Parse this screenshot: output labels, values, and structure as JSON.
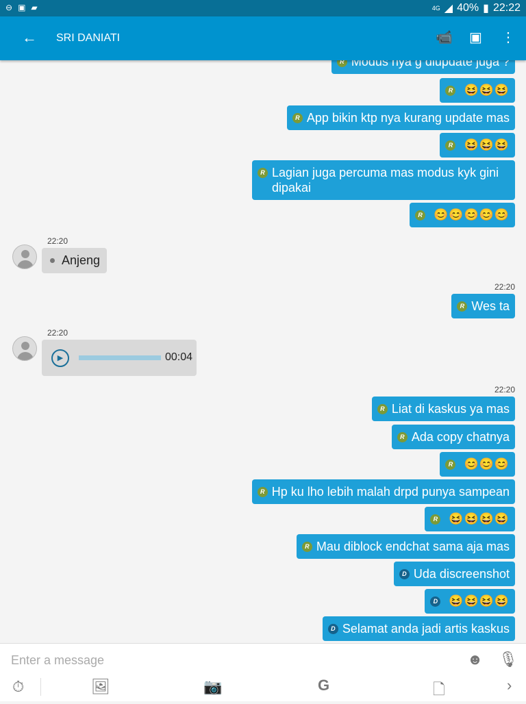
{
  "status": {
    "battery": "40%",
    "time": "22:22",
    "network": "4G"
  },
  "header": {
    "title": "SRI DANIATI"
  },
  "messages_top": [
    {
      "badge": "R",
      "text": "Modus nya g diupdate juga ?"
    },
    {
      "badge": "R",
      "emoji": "😆😆😆"
    },
    {
      "badge": "R",
      "text": "App bikin ktp nya kurang update mas"
    },
    {
      "badge": "R",
      "emoji": "😆😆😆"
    },
    {
      "badge": "R",
      "text": "Lagian juga percuma mas modus kyk gini dipakai"
    },
    {
      "badge": "R",
      "emoji": "😊😊😊😊😊"
    }
  ],
  "incoming1": {
    "time": "22:20",
    "text": "Anjeng"
  },
  "outgoing1": {
    "time": "22:20",
    "badge": "R",
    "text": "Wes ta"
  },
  "voice": {
    "time": "22:20",
    "duration": "00:04"
  },
  "outgoing_time": "22:20",
  "messages_bottom": [
    {
      "badge": "R",
      "text": "Liat di kaskus ya mas"
    },
    {
      "badge": "R",
      "text": "Ada copy chatnya"
    },
    {
      "badge": "R",
      "emoji": "😊😊😊"
    },
    {
      "badge": "R",
      "text": "Hp ku lho lebih malah drpd punya sampean"
    },
    {
      "badge": "R",
      "emoji": "😆😆😆😆"
    },
    {
      "badge": "R",
      "text": "Mau diblock endchat sama aja mas"
    },
    {
      "badge": "D",
      "text": "Uda discreenshot"
    },
    {
      "badge": "D",
      "emoji": "😆😆😆😆"
    },
    {
      "badge": "D",
      "text": "Selamat anda jadi artis kaskus"
    }
  ],
  "composer": {
    "placeholder": "Enter a message"
  }
}
